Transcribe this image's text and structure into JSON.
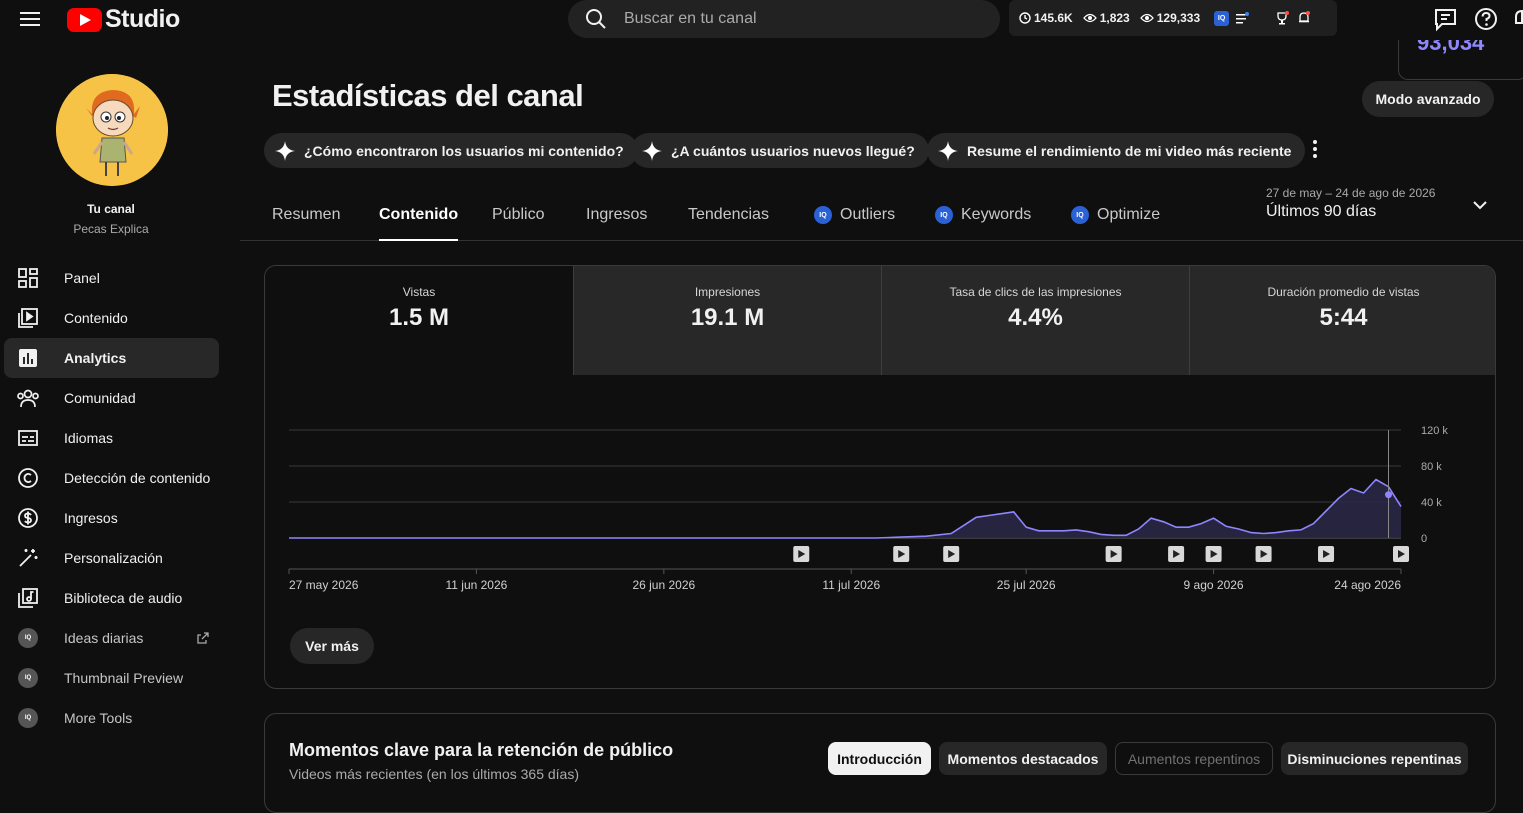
{
  "header": {
    "logo_text": "Studio",
    "search_placeholder": "Buscar en tu canal",
    "stats": {
      "watch": "145.6K",
      "views_now": "1,823",
      "views_total": "129,333"
    },
    "float_value": "93,034"
  },
  "sidebar": {
    "channel_title": "Tu canal",
    "channel_name": "Pecas Explica",
    "items": [
      {
        "label": "Panel",
        "icon": "dashboard-icon"
      },
      {
        "label": "Contenido",
        "icon": "content-icon"
      },
      {
        "label": "Analytics",
        "icon": "analytics-icon",
        "active": true
      },
      {
        "label": "Comunidad",
        "icon": "community-icon"
      },
      {
        "label": "Idiomas",
        "icon": "subtitles-icon"
      },
      {
        "label": "Detección de contenido",
        "icon": "copyright-icon"
      },
      {
        "label": "Ingresos",
        "icon": "dollar-icon"
      },
      {
        "label": "Personalización",
        "icon": "magic-wand-icon"
      },
      {
        "label": "Biblioteca de audio",
        "icon": "audio-library-icon"
      }
    ],
    "tools": [
      {
        "label": "Ideas diarias"
      },
      {
        "label": "Thumbnail Preview"
      },
      {
        "label": "More Tools"
      }
    ]
  },
  "main": {
    "title": "Estadísticas del canal",
    "advanced_button": "Modo avanzado",
    "chips": [
      "¿Cómo encontraron los usuarios mi contenido?",
      "¿A cuántos usuarios nuevos llegué?",
      "Resume el rendimiento de mi video más reciente"
    ],
    "tabs": [
      "Resumen",
      "Contenido",
      "Público",
      "Ingresos",
      "Tendencias",
      "Outliers",
      "Keywords",
      "Optimize"
    ],
    "active_tab": "Contenido",
    "date_range_sub": "27 de may – 24 de ago de 2026",
    "date_range": "Últimos 90 días"
  },
  "metrics": [
    {
      "label": "Vistas",
      "value": "1.5 M"
    },
    {
      "label": "Impresiones",
      "value": "19.1 M"
    },
    {
      "label": "Tasa de clics de las impresiones",
      "value": "4.4%"
    },
    {
      "label": "Duración promedio de vistas",
      "value": "5:44"
    }
  ],
  "see_more": "Ver más",
  "retention": {
    "title": "Momentos clave para la retención de público",
    "subtitle": "Videos más recientes (en los últimos 365 días)",
    "segments": [
      "Introducción",
      "Momentos destacados",
      "Aumentos repentinos",
      "Disminuciones repentinas"
    ]
  },
  "chart_data": {
    "type": "area",
    "x": [
      "2026-05-27",
      "2026-06-03",
      "2026-06-10",
      "2026-06-17",
      "2026-06-24",
      "2026-07-01",
      "2026-07-08",
      "2026-07-13",
      "2026-07-15",
      "2026-07-17",
      "2026-07-19",
      "2026-07-20",
      "2026-07-21",
      "2026-07-22",
      "2026-07-24",
      "2026-07-25",
      "2026-07-26",
      "2026-07-27",
      "2026-07-28",
      "2026-07-29",
      "2026-07-30",
      "2026-07-31",
      "2026-08-01",
      "2026-08-02",
      "2026-08-03",
      "2026-08-04",
      "2026-08-05",
      "2026-08-06",
      "2026-08-07",
      "2026-08-08",
      "2026-08-09",
      "2026-08-10",
      "2026-08-11",
      "2026-08-12",
      "2026-08-13",
      "2026-08-14",
      "2026-08-15",
      "2026-08-16",
      "2026-08-17",
      "2026-08-18",
      "2026-08-19",
      "2026-08-20",
      "2026-08-21",
      "2026-08-22",
      "2026-08-23",
      "2026-08-24"
    ],
    "series": [
      {
        "values": [
          0,
          0,
          0,
          0,
          0,
          0,
          0,
          0,
          1,
          2,
          5,
          14,
          23,
          25,
          29,
          12,
          8,
          8,
          8,
          9,
          7,
          4,
          3,
          3,
          10,
          22,
          18,
          12,
          12,
          16,
          22,
          13,
          10,
          6,
          5,
          6,
          8,
          9,
          16,
          30,
          44,
          55,
          50,
          65,
          57,
          35
        ],
        "color": "#8e86ff"
      }
    ],
    "xticks": [
      "27 may 2026",
      "11 jun 2026",
      "26 jun 2026",
      "11 jul 2026",
      "25 jul 2026",
      "9 ago 2026",
      "24 ago 2026"
    ],
    "yticks": [
      "0",
      "40 k",
      "80 k",
      "120 k"
    ],
    "ylim": [
      0,
      120
    ],
    "y_unit": "k",
    "upload_markers": [
      "2026-07-07",
      "2026-07-15",
      "2026-07-19",
      "2026-08-01",
      "2026-08-06",
      "2026-08-09",
      "2026-08-13",
      "2026-08-18",
      "2026-08-24"
    ]
  }
}
